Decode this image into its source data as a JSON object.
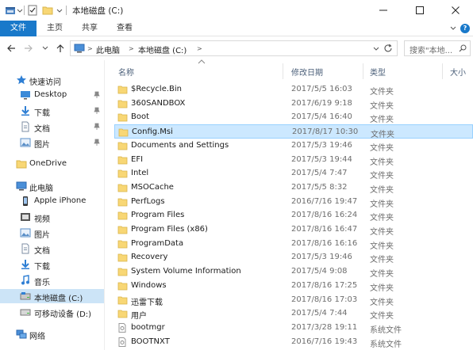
{
  "window": {
    "title": "本地磁盘 (C:)",
    "minimize_glyph": "—",
    "maximize_glyph": "☐",
    "close_glyph": "✕"
  },
  "ribbon": {
    "tabs": [
      "文件",
      "主页",
      "共享",
      "查看"
    ],
    "help_glyph": "?"
  },
  "address": {
    "crumbs": [
      "此电脑",
      "本地磁盘 (C:)"
    ],
    "search_placeholder": "搜索\"本地..."
  },
  "columns": [
    "名称",
    "修改日期",
    "类型",
    "大小"
  ],
  "nav": {
    "quick_access": "快速访问",
    "quick_items": [
      {
        "label": "Desktop",
        "icon": "desktop-icon"
      },
      {
        "label": "下载",
        "icon": "download-icon"
      },
      {
        "label": "文档",
        "icon": "document-icon"
      },
      {
        "label": "图片",
        "icon": "picture-icon"
      }
    ],
    "onedrive": "OneDrive",
    "this_pc": "此电脑",
    "pc_items": [
      {
        "label": "Apple iPhone",
        "icon": "phone-icon"
      },
      {
        "label": "视频",
        "icon": "video-icon"
      },
      {
        "label": "图片",
        "icon": "picture-icon"
      },
      {
        "label": "文档",
        "icon": "document-icon"
      },
      {
        "label": "下载",
        "icon": "download-icon"
      },
      {
        "label": "音乐",
        "icon": "music-icon"
      },
      {
        "label": "本地磁盘 (C:)",
        "icon": "drive-icon"
      },
      {
        "label": "可移动设备 (D:)",
        "icon": "removable-drive-icon"
      }
    ],
    "network": "网络"
  },
  "files": [
    {
      "name": "$Recycle.Bin",
      "date": "2017/5/5 16:03",
      "type": "文件夹",
      "kind": "folder"
    },
    {
      "name": "360SANDBOX",
      "date": "2017/6/19 9:18",
      "type": "文件夹",
      "kind": "folder"
    },
    {
      "name": "Boot",
      "date": "2017/5/4 16:40",
      "type": "文件夹",
      "kind": "folder"
    },
    {
      "name": "Config.Msi",
      "date": "2017/8/17 10:30",
      "type": "文件夹",
      "kind": "folder",
      "selected": true
    },
    {
      "name": "Documents and Settings",
      "date": "2017/5/3 19:46",
      "type": "文件夹",
      "kind": "folder"
    },
    {
      "name": "EFI",
      "date": "2017/5/3 19:44",
      "type": "文件夹",
      "kind": "folder"
    },
    {
      "name": "Intel",
      "date": "2017/5/4 7:47",
      "type": "文件夹",
      "kind": "folder"
    },
    {
      "name": "MSOCache",
      "date": "2017/5/5 8:32",
      "type": "文件夹",
      "kind": "folder"
    },
    {
      "name": "PerfLogs",
      "date": "2016/7/16 19:47",
      "type": "文件夹",
      "kind": "folder"
    },
    {
      "name": "Program Files",
      "date": "2017/8/16 16:24",
      "type": "文件夹",
      "kind": "folder"
    },
    {
      "name": "Program Files (x86)",
      "date": "2017/8/16 16:47",
      "type": "文件夹",
      "kind": "folder"
    },
    {
      "name": "ProgramData",
      "date": "2017/8/16 16:16",
      "type": "文件夹",
      "kind": "folder"
    },
    {
      "name": "Recovery",
      "date": "2017/5/3 19:46",
      "type": "文件夹",
      "kind": "folder"
    },
    {
      "name": "System Volume Information",
      "date": "2017/5/4 9:08",
      "type": "文件夹",
      "kind": "folder"
    },
    {
      "name": "Windows",
      "date": "2017/8/16 17:25",
      "type": "文件夹",
      "kind": "folder"
    },
    {
      "name": "迅雷下载",
      "date": "2017/8/16 17:03",
      "type": "文件夹",
      "kind": "folder"
    },
    {
      "name": "用户",
      "date": "2017/5/4 7:44",
      "type": "文件夹",
      "kind": "folder"
    },
    {
      "name": "bootmgr",
      "date": "2017/3/28 19:11",
      "type": "系统文件",
      "kind": "system"
    },
    {
      "name": "BOOTNXT",
      "date": "2016/7/16 19:43",
      "type": "系统文件",
      "kind": "system"
    }
  ],
  "colors": {
    "accent": "#1979ca",
    "folder": "#f8d775",
    "selection": "#cce8ff",
    "nav_selection": "#cce4f7"
  }
}
